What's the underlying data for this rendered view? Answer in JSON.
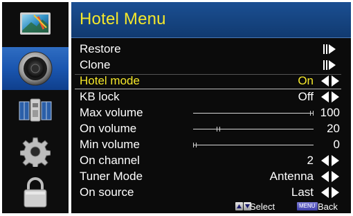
{
  "sidebar": {
    "items": [
      {
        "icon": "picture-icon",
        "active": false
      },
      {
        "icon": "speaker-icon",
        "active": true
      },
      {
        "icon": "satellite-icon",
        "active": false
      },
      {
        "icon": "gear-icon",
        "active": false
      },
      {
        "icon": "lock-icon",
        "active": false
      }
    ]
  },
  "menu": {
    "title": "Hotel Menu",
    "items": [
      {
        "label": "Restore",
        "control": "enter"
      },
      {
        "label": "Clone",
        "control": "enter"
      },
      {
        "label": "Hotel mode",
        "value": "On",
        "control": "toggle",
        "selected": true
      },
      {
        "label": "KB lock",
        "value": "Off",
        "control": "toggle"
      },
      {
        "label": "Max volume",
        "value": "100",
        "control": "slider",
        "level": 1.0
      },
      {
        "label": "On volume",
        "value": "20",
        "control": "slider",
        "level": 0.2
      },
      {
        "label": "Min volume",
        "value": "0",
        "control": "slider",
        "level": 0.0
      },
      {
        "label": "On channel",
        "value": "2",
        "control": "toggle"
      },
      {
        "label": "Tuner Mode",
        "value": "Antenna",
        "control": "toggle"
      },
      {
        "label": "On source",
        "value": "Last",
        "control": "toggle"
      }
    ]
  },
  "footer": {
    "select_label": "Select",
    "menu_key": "MENU",
    "back_label": "Back"
  },
  "colors": {
    "title_bar": "#1b4f92",
    "highlight_text": "#f5e82a",
    "active_tab": "#1a56b0",
    "panel_bg": "#0b0b0b"
  }
}
